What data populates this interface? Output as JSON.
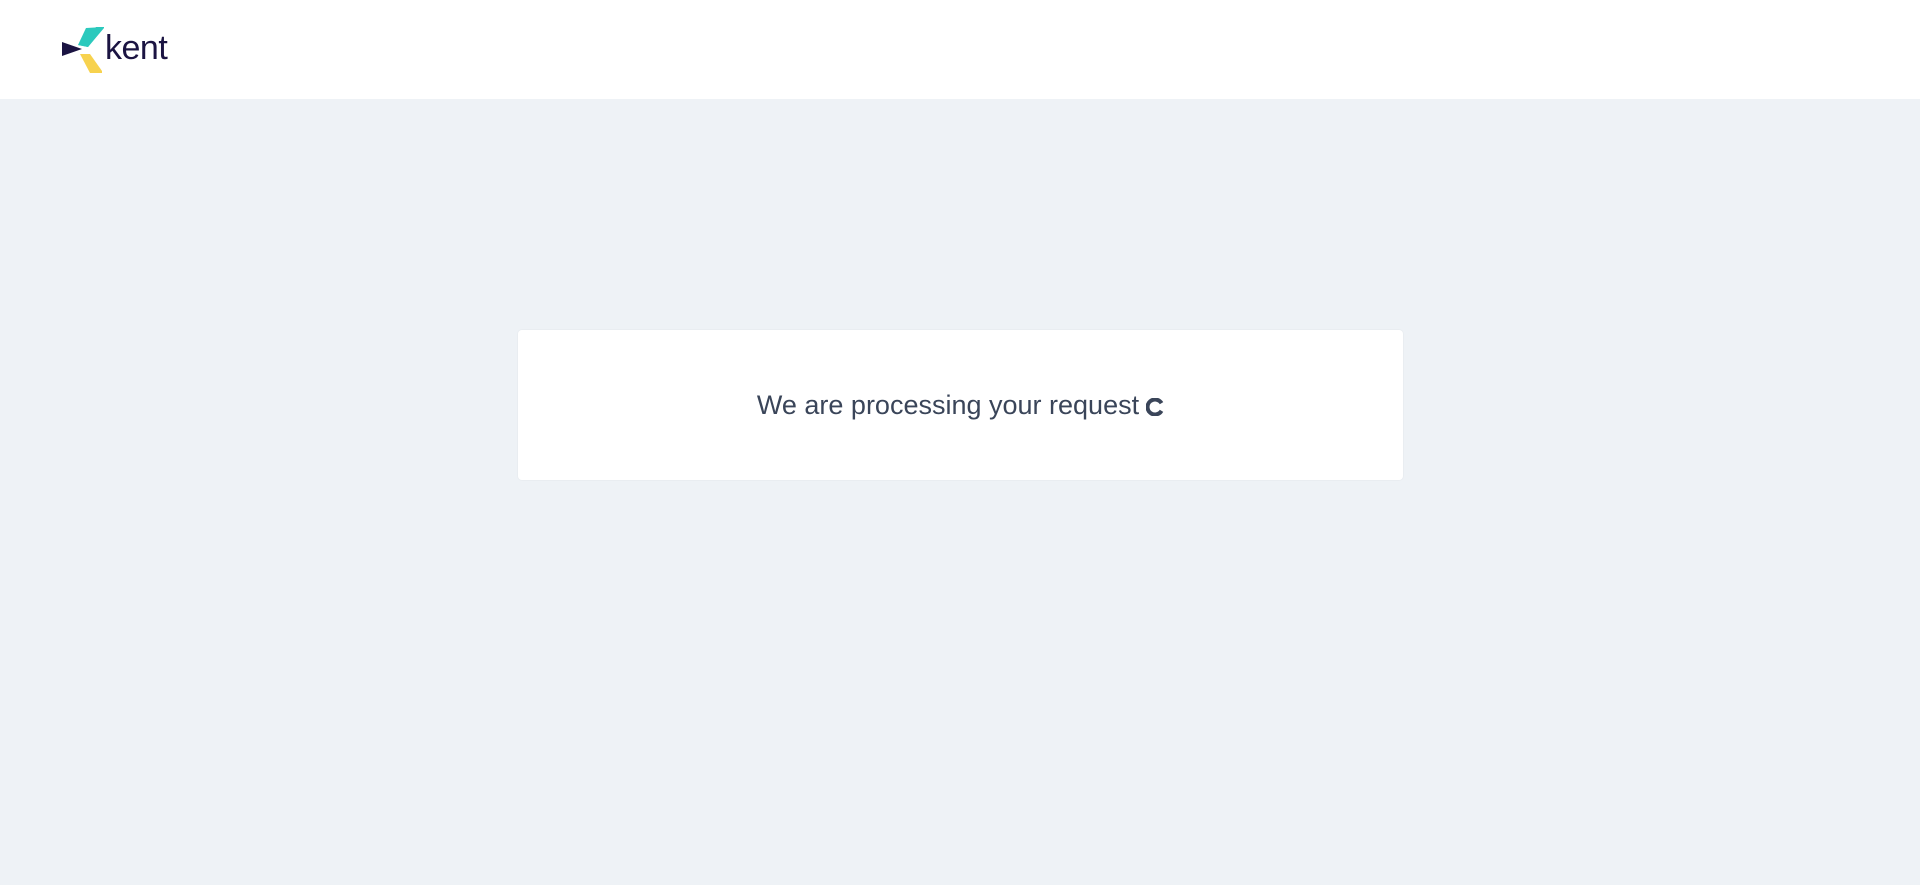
{
  "header": {
    "brand_name": "kent",
    "logo_colors": {
      "teal": "#2cc9bd",
      "navy": "#1b1442",
      "yellow": "#f7d24e"
    }
  },
  "status_card": {
    "message": "We are processing your request",
    "indicator_icon": "loading-spinner-icon",
    "indicator_color": "#3a4559"
  },
  "colors": {
    "page_background": "#eef2f6",
    "header_background": "#ffffff",
    "card_background": "#ffffff",
    "text": "#3a4559"
  }
}
